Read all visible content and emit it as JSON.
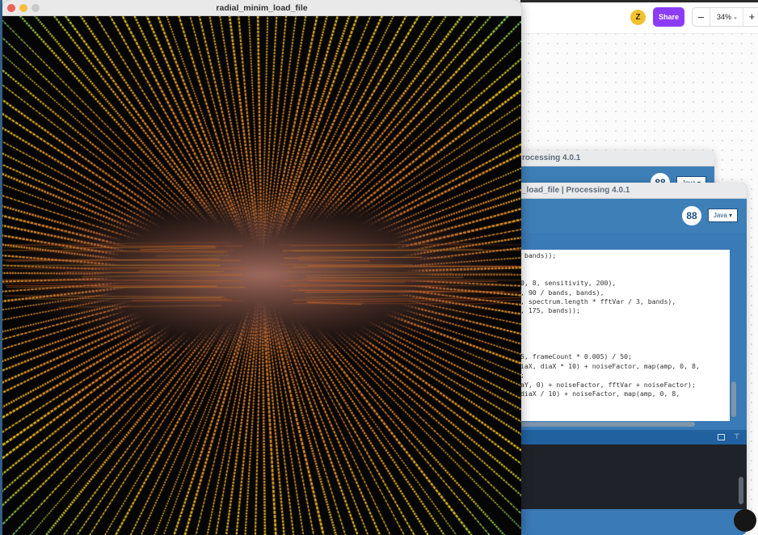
{
  "background_app": {
    "avatar_initial": "Z",
    "share_label": "Share",
    "zoom": {
      "minus": "–",
      "level": "34%",
      "chevron": "⌄",
      "plus": "+"
    }
  },
  "ide_back": {
    "title": "rocessing 4.0.1",
    "logo": "88",
    "mode": "Java ▾"
  },
  "ide_front": {
    "title": "_load_file | Processing 4.0.1",
    "logo": "88",
    "mode": "Java ▾",
    "code_lines": [
      " bands));",
      "",
      "",
      "0, 8, sensitivity, 200),",
      ", 90 / bands, bands),",
      ", spectrum.length * fftVar / 3, bands),",
      ", 175, bands));",
      "",
      "",
      "",
      "",
      "5, frameCount * 0.005) / 50;",
      "iaX, diaX * 10) + noiseFactor, map(amp, 0, 8,",
      ";",
      "aY, 0) + noiseFactor, fftVar + noiseFactor);",
      "diaX / 10) + noiseFactor, map(amp, 0, 8,",
      ""
    ]
  },
  "sketch": {
    "title": "radial_minim_load_file",
    "colors": {
      "center_glow": "#a46a5a",
      "ray_inner": "#c26a2a",
      "ray_mid": "#e28a28",
      "ray_outer": "#e6c21c",
      "ray_edge_green": "#58c26a",
      "ray_edge_blue": "#2a6ee8"
    }
  }
}
